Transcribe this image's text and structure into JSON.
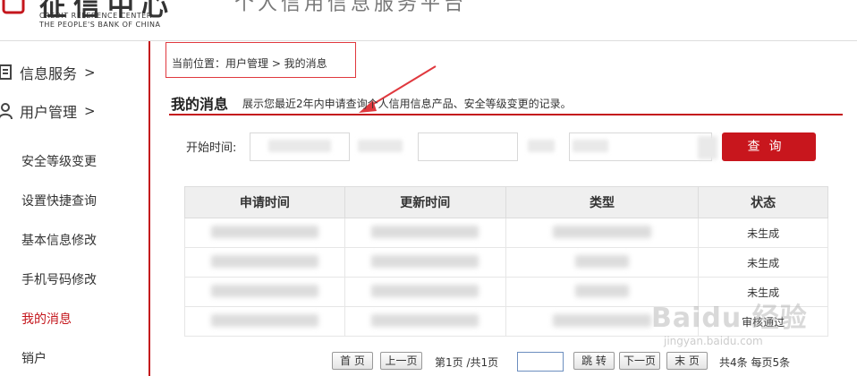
{
  "header": {
    "logo_cn": "征信中心",
    "logo_en_line1": "CREDIT REFERENCE CENTER",
    "logo_en_line2": "THE PEOPLE'S BANK OF CHINA",
    "site_title": "个人信用信息服务平台"
  },
  "sidebar": {
    "groups": [
      {
        "label": "信息服务",
        "chevron": ">"
      },
      {
        "label": "用户管理",
        "chevron": ">"
      }
    ],
    "items": [
      {
        "label": "安全等级变更"
      },
      {
        "label": "设置快捷查询"
      },
      {
        "label": "基本信息修改"
      },
      {
        "label": "手机号码修改"
      },
      {
        "label": "我的消息",
        "active": true
      },
      {
        "label": "销户"
      }
    ]
  },
  "breadcrumb": "当前位置：用户管理  > 我的消息",
  "section": {
    "title": "我的消息",
    "description": "展示您最近2年内申请查询个人信用信息产品、安全等级变更的记录。"
  },
  "filter": {
    "start_label": "开始时间:",
    "search_label": "查询"
  },
  "table": {
    "headers": [
      "申请时间",
      "更新时间",
      "类型",
      "状态"
    ],
    "rows": [
      {
        "status": "未生成"
      },
      {
        "status": "未生成"
      },
      {
        "status": "未生成"
      },
      {
        "status": "审核通过"
      }
    ]
  },
  "pager": {
    "first": "首 页",
    "prev": "上一页",
    "page_info": "第1页 /共1页",
    "jump": "跳 转",
    "next": "下一页",
    "last": "末 页",
    "total": "共4条  每页5条"
  },
  "watermark": {
    "text": "Baidu 经验",
    "url": "jingyan.baidu.com"
  },
  "colors": {
    "accent": "#c4161c",
    "button": "#c8161d"
  }
}
